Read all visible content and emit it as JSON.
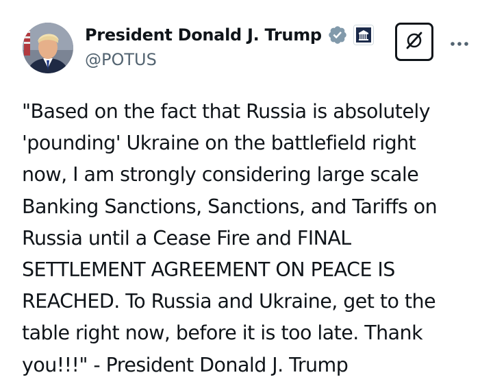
{
  "author": {
    "display_name": "President Donald J. Trump",
    "handle": "@POTUS",
    "verified_badge_color": "#829aab",
    "icons": {
      "verified": "verified-badge-icon",
      "affiliate": "white-house-icon"
    }
  },
  "actions": {
    "grok_icon": "grok-icon",
    "more_icon": "more-icon"
  },
  "tweet": {
    "lines": [
      "\"Based on the fact that Russia is absolutely",
      "'pounding' Ukraine on the battlefield right",
      "now, I am strongly considering large scale",
      "Banking Sanctions, Sanctions, and Tariffs on",
      "Russia until a Cease Fire and FINAL",
      "SETTLEMENT AGREEMENT ON PEACE IS",
      "REACHED. To Russia and Ukraine, get to the",
      "table right now, before it is too late. Thank",
      "you!!!\" - President Donald J. Trump"
    ]
  },
  "colors": {
    "text": "#0f1419",
    "secondary_text": "#536471",
    "background": "#ffffff"
  }
}
